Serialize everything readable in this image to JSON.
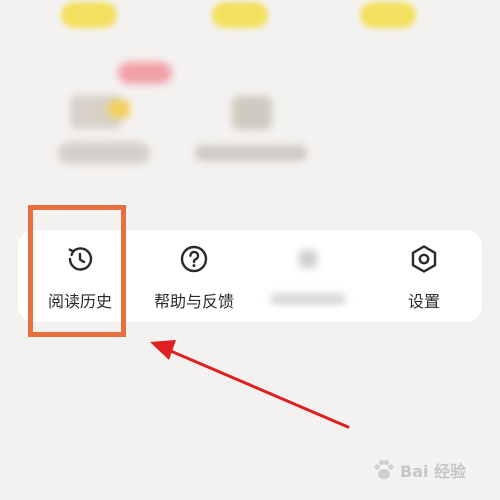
{
  "colors": {
    "accent_yellow": "#f3e05f",
    "highlight_box": "#e8703f",
    "arrow": "#e02020",
    "card_bg": "#ffffff",
    "page_bg": "#f4f2f0"
  },
  "tools": [
    {
      "label": "阅读历史",
      "icon": "clock-history-icon"
    },
    {
      "label": "帮助与反馈",
      "icon": "help-circle-icon"
    },
    {
      "label": "",
      "icon": "blurred-icon"
    },
    {
      "label": "设置",
      "icon": "settings-hexagon-icon"
    }
  ],
  "watermark": {
    "text": "Bai 经验",
    "icon": "paw-logo-icon"
  }
}
